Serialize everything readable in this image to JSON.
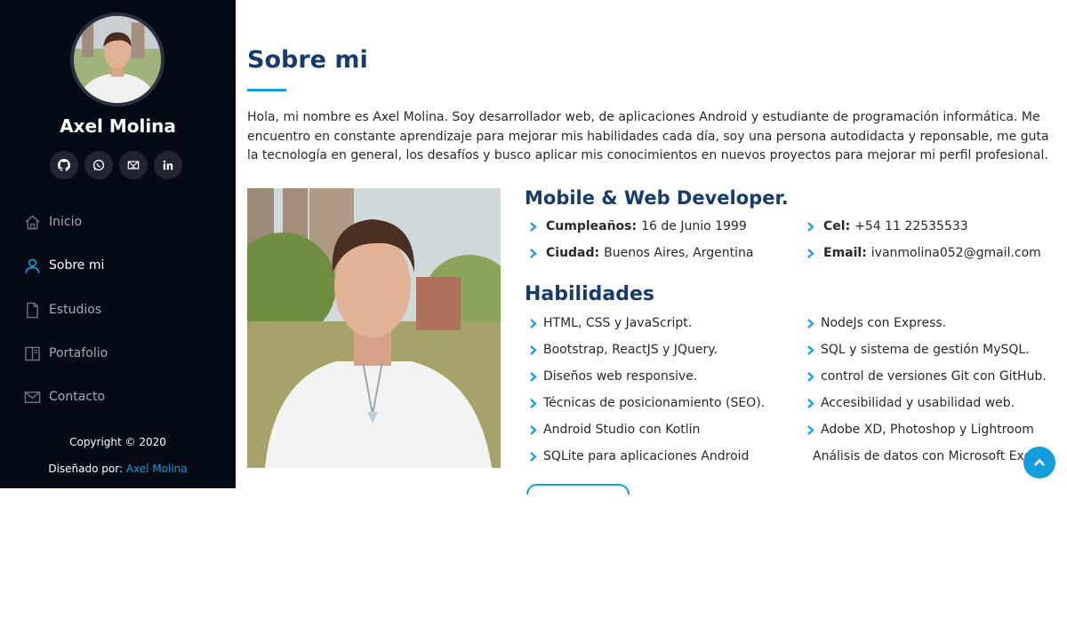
{
  "profile": {
    "name": "Axel Molina",
    "social": [
      {
        "icon": "github-icon"
      },
      {
        "icon": "whatsapp-icon"
      },
      {
        "icon": "mail-icon"
      },
      {
        "icon": "linkedin-icon"
      }
    ]
  },
  "nav": [
    {
      "label": "Inicio",
      "icon": "home-icon",
      "active": false
    },
    {
      "label": "Sobre mi",
      "icon": "person-icon",
      "active": true
    },
    {
      "label": "Estudios",
      "icon": "file-icon",
      "active": false
    },
    {
      "label": "Portafolio",
      "icon": "book-icon",
      "active": false
    },
    {
      "label": "Contacto",
      "icon": "envelope-icon",
      "active": false
    }
  ],
  "footer": {
    "copyright": "Copyright © 2020",
    "credits_prefix": "Diseñado por:",
    "credits_link": "Axel Molina"
  },
  "about": {
    "title": "Sobre mi",
    "intro": "Hola, mi nombre es Axel Molina. Soy desarrollador web, de aplicaciones Android y estudiante de programación informática. Me encuentro en constante aprendizaje para mejorar mis habilidades cada día, soy una persona autodidacta y reponsable, me guta la tecnología en general, los desafíos y busco aplicar mis conocimientos en nuevos proyectos para mejorar mi perfil profesional.",
    "role": "Mobile & Web Developer.",
    "info": [
      {
        "key": "Cumpleaños:",
        "value": "16 de Junio 1999"
      },
      {
        "key": "Cel:",
        "value": "+54 11 22535533"
      },
      {
        "key": "Ciudad:",
        "value": "Buenos Aires, Argentina"
      },
      {
        "key": "Email:",
        "value": "ivanmolina052@gmail.com"
      }
    ],
    "skills_title": "Habilidades",
    "skills_left": [
      "HTML, CSS y JavaScript.",
      "Bootstrap, ReactJS y JQuery.",
      "Diseños web responsive.",
      "Técnicas de posicionamiento (SEO).",
      "Android Studio con Kotlin",
      "SQLite para aplicaciones Android"
    ],
    "skills_right": [
      "NodeJs con Express.",
      "SQL y sistema de gestión MySQL.",
      "control de versiones Git con GitHub.",
      "Accesibilidad y usabilidad web.",
      "Adobe XD, Photoshop y Lightroom",
      "Análisis de datos con Microsoft Excel"
    ]
  },
  "colors": {
    "accent": "#149ddd",
    "heading": "#173b6c",
    "sidebar_bg": "#040b14"
  }
}
